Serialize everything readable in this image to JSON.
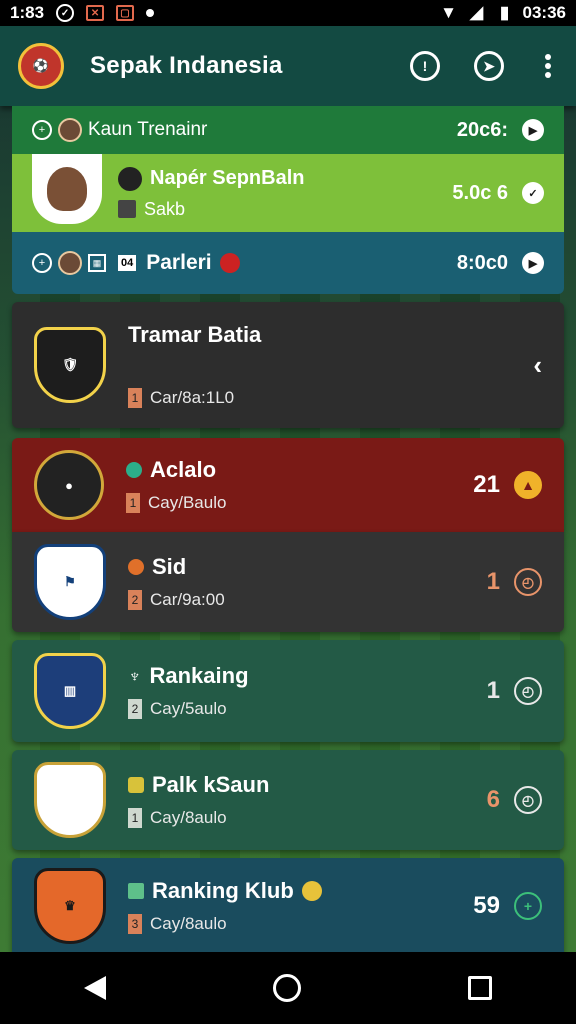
{
  "status_bar": {
    "time": "1:83",
    "right_time": "03:36"
  },
  "app_bar": {
    "title": "Sepak Indanesia",
    "logo_icon": "club-crest-icon"
  },
  "rows": [
    {
      "title": "Kaun Trenainr",
      "value": "20c6:"
    },
    {
      "title": "Napér SepnBaln",
      "subtitle": "Sakb",
      "value": "5.0c 6"
    },
    {
      "title": "Parleri",
      "tag": "04",
      "value": "8:0c0"
    }
  ],
  "cards": [
    {
      "name": "Tramar Batia",
      "sub": "Car/8a:1L0",
      "chip": "1",
      "score": "",
      "color": "#2d2d2d"
    },
    {
      "name": "Aclalo",
      "sub": "Cay/Baulo",
      "chip": "1",
      "score": "21",
      "color": "#7a1a16"
    },
    {
      "name": "Sid",
      "sub": "Car/9a:00",
      "chip": "2",
      "score": "1",
      "color": "#333333"
    },
    {
      "name": "Rankaing",
      "sub": "Cay/5aulo",
      "chip": "2",
      "score": "1",
      "color": "#235a46"
    },
    {
      "name": "Palk kSaun",
      "sub": "Cay/8aulo",
      "chip": "1",
      "score": "6",
      "color": "#235a46"
    },
    {
      "name": "Ranking Klub",
      "sub": "Cay/8aulo",
      "chip": "3",
      "score": "59",
      "color": "#1a4c5e"
    }
  ]
}
